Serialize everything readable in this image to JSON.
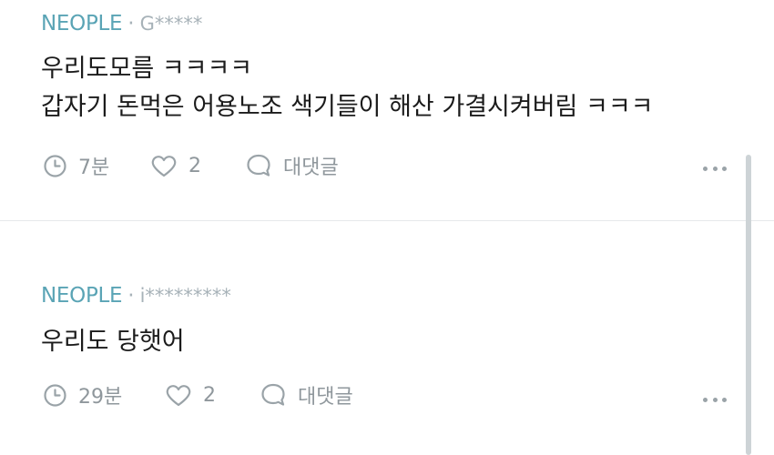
{
  "comments": [
    {
      "company": "NEOPLE",
      "separator": "·",
      "user": "G*****",
      "lines": [
        "우리도모름 ㅋㅋㅋㅋ",
        "갑자기 돈먹은 어용노조 색기들이 해산 가결시켜버림 ㅋㅋㅋ"
      ],
      "time": "7분",
      "likes": "2",
      "reply_label": "대댓글"
    },
    {
      "company": "NEOPLE",
      "separator": "·",
      "user": "i*********",
      "lines": [
        "우리도 당햇어"
      ],
      "time": "29분",
      "likes": "2",
      "reply_label": "대댓글"
    }
  ],
  "icons": {
    "time": "clock-icon",
    "like": "heart-icon",
    "reply": "speech-bubble-icon",
    "more": "more-dots-icon"
  },
  "colors": {
    "company": "#5aa4b5",
    "muted": "#9aa3a8",
    "text": "#1b1b1b",
    "divider": "#e6e9eb"
  }
}
